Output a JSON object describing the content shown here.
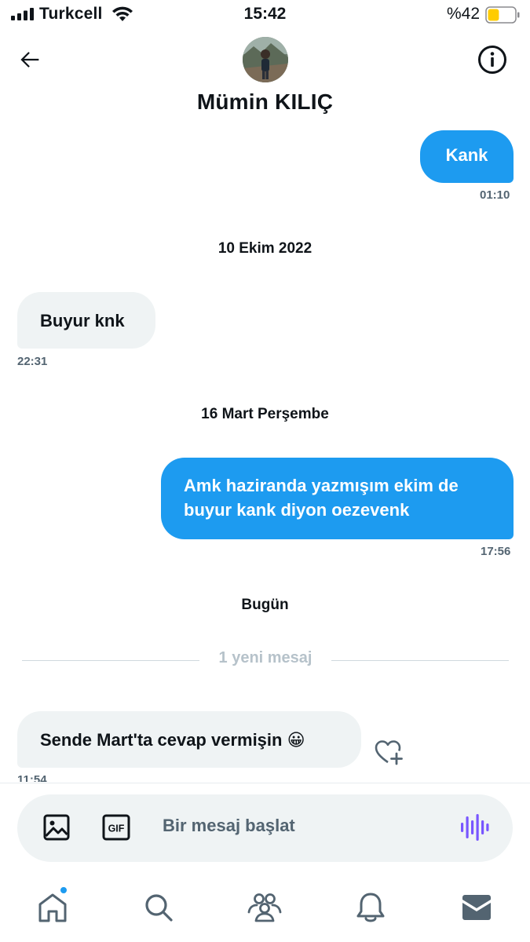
{
  "status_bar": {
    "carrier": "Turkcell",
    "time": "15:42",
    "battery_percent": "%42",
    "battery_level": 0.42,
    "battery_color": "#ffcc00"
  },
  "header": {
    "contact_name": "Mümin KILIÇ",
    "back_icon": "arrow-left-icon",
    "info_icon": "info-icon"
  },
  "messages": [
    {
      "direction": "out",
      "text": "Kank",
      "time": "01:10"
    },
    {
      "type": "date",
      "text": "10 Ekim 2022"
    },
    {
      "direction": "in",
      "text": "Buyur knk",
      "time": "22:31"
    },
    {
      "type": "date",
      "text": "16 Mart Perşembe"
    },
    {
      "direction": "out",
      "text_lines": [
        "Amk haziranda yazmışım ekim de",
        "buyur kank diyon oezevenk"
      ],
      "time": "17:56"
    },
    {
      "type": "date",
      "text": "Bugün"
    },
    {
      "type": "new_divider",
      "text": "1 yeni mesaj"
    },
    {
      "direction": "in",
      "text": "Sende Mart'ta cevap vermişin 😀",
      "time": "11:54"
    }
  ],
  "composer": {
    "placeholder": "Bir mesaj başlat",
    "icons": [
      "image-icon",
      "gif-icon",
      "voice-icon"
    ]
  },
  "bottom_nav": {
    "items": [
      "home-icon",
      "search-icon",
      "communities-icon",
      "notifications-icon",
      "messages-icon"
    ]
  },
  "colors": {
    "accent": "#1d9bf0",
    "incoming_bubble": "#eff3f4",
    "muted_text": "#536471",
    "voice_accent": "#7856ff"
  }
}
